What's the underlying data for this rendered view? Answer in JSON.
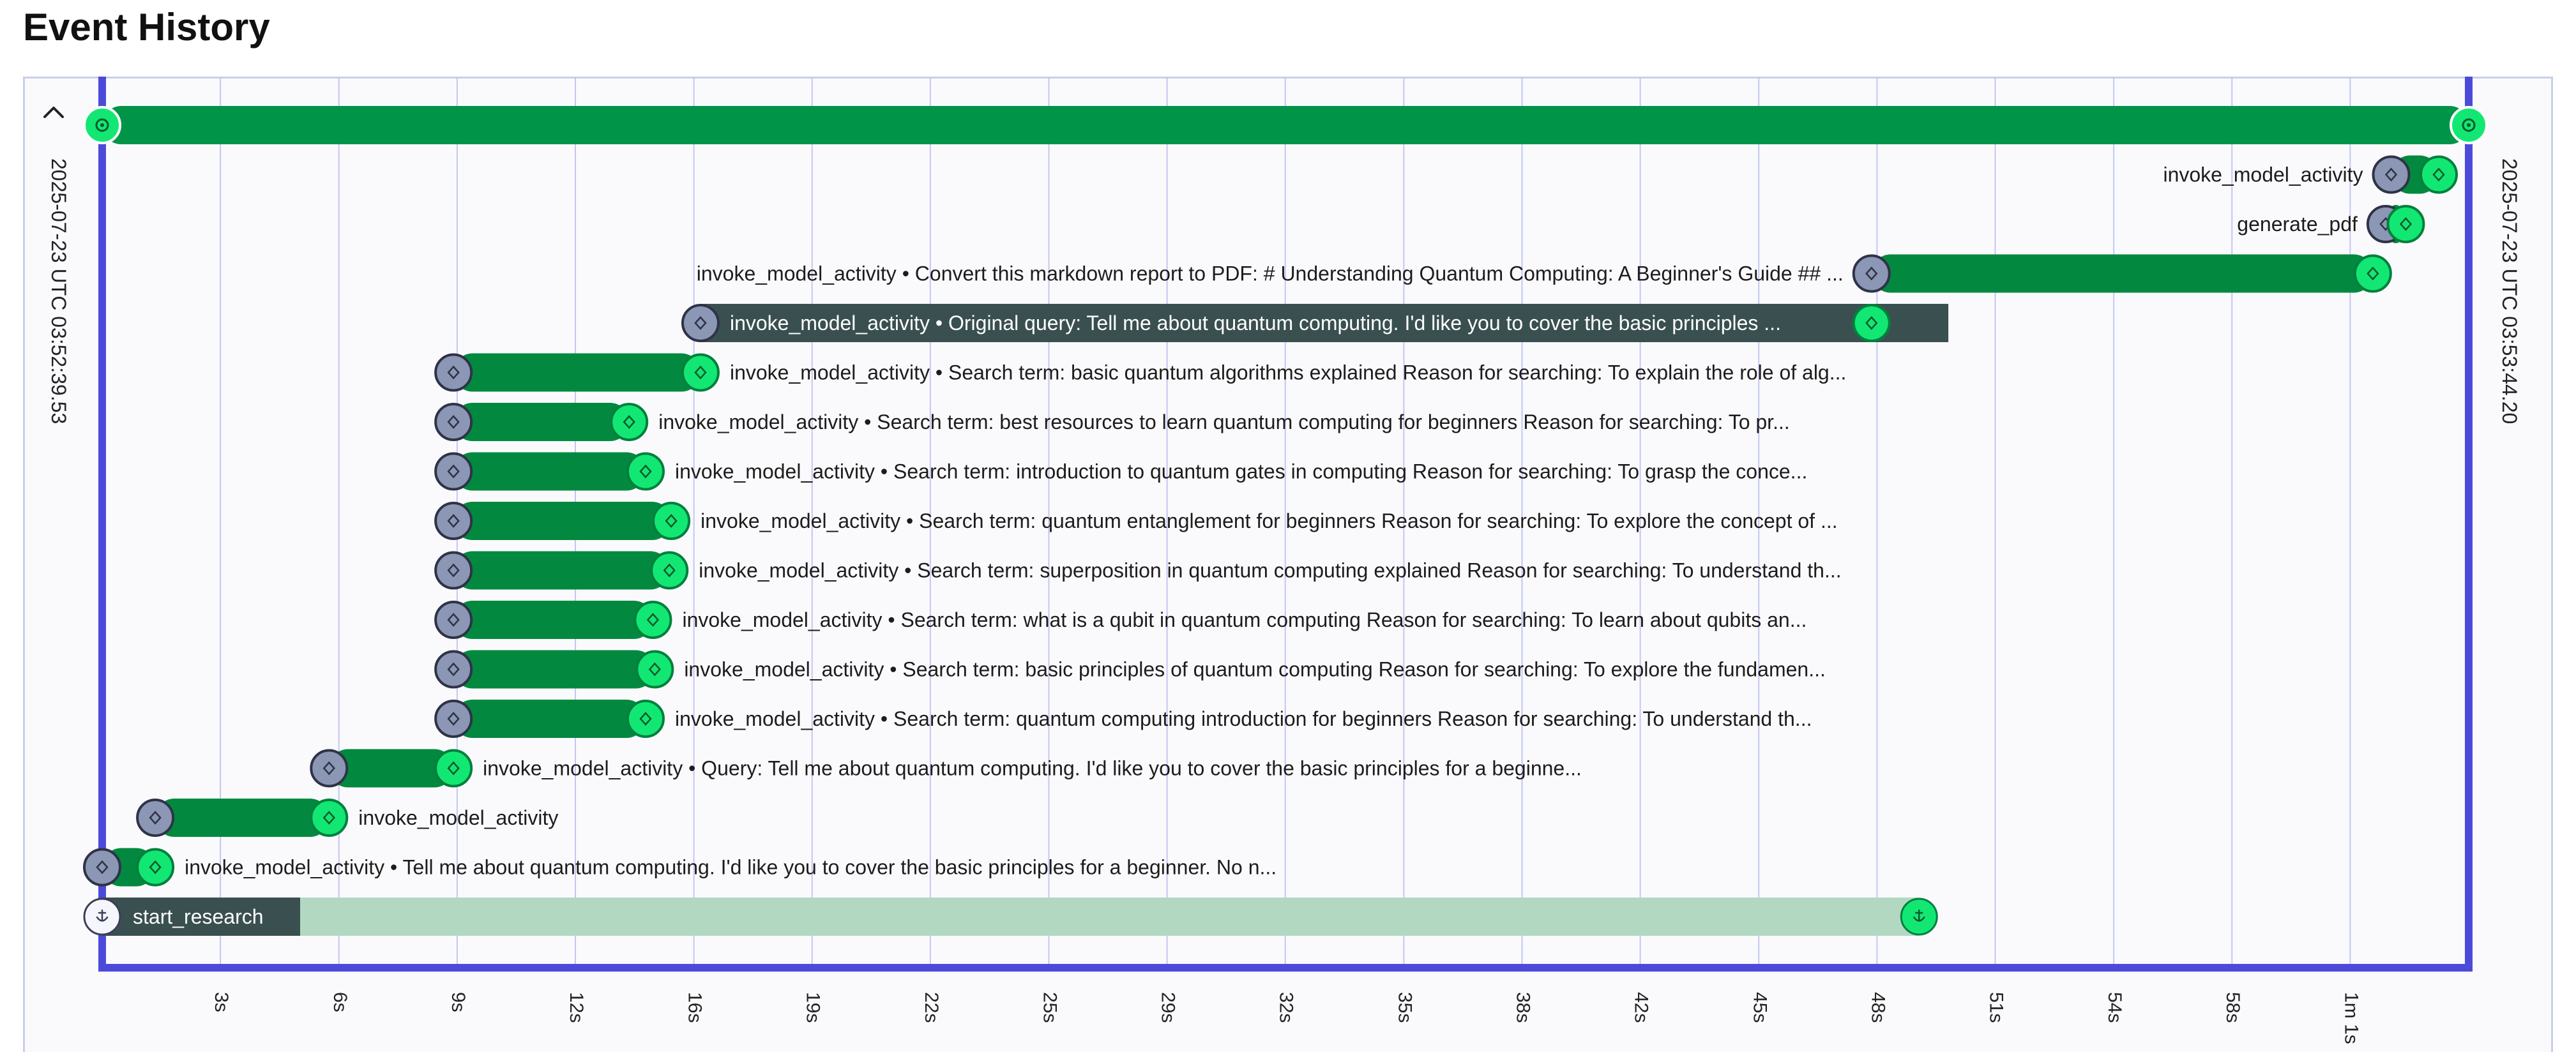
{
  "page": {
    "title": "Event History"
  },
  "timeline": {
    "start_label": "2025-07-23 UTC 03:52:39.53",
    "end_label": "2025-07-23 UTC 03:53:44.20",
    "duration_s": 64.67,
    "ticks": [
      "3s",
      "6s",
      "9s",
      "12s",
      "16s",
      "19s",
      "22s",
      "25s",
      "29s",
      "32s",
      "35s",
      "38s",
      "42s",
      "45s",
      "48s",
      "51s",
      "54s",
      "58s",
      "1m 1s"
    ],
    "tick_seconds": [
      3.23,
      6.47,
      9.7,
      12.93,
      16.17,
      19.4,
      22.63,
      25.87,
      29.1,
      32.33,
      35.57,
      38.8,
      42.03,
      45.27,
      48.5,
      51.73,
      54.97,
      58.2,
      61.43
    ],
    "colors": {
      "workflow": "#009448",
      "activity": "#02893f",
      "timer": "#b3d8c2",
      "start_node": "#8b97b4",
      "end_node": "#13e773",
      "frame": "#4c4bd9",
      "grid": "#c3c7f0",
      "highlight_label": "#3a5050"
    },
    "events": [
      {
        "start": 0,
        "end": 64.67,
        "label": "",
        "kind": "workflow",
        "row": 0,
        "side": "none"
      },
      {
        "start": 62.55,
        "end": 63.85,
        "label": "invoke_model_activity",
        "kind": "activity",
        "row": 1,
        "side": "left"
      },
      {
        "start": 62.4,
        "end": 62.95,
        "label": "generate_pdf",
        "kind": "activity",
        "row": 2,
        "side": "left"
      },
      {
        "start": 48.35,
        "end": 62.05,
        "label": "invoke_model_activity • Convert this markdown report to PDF: # Understanding Quantum Computing: A Beginner's Guide ## ...",
        "kind": "activity",
        "row": 3,
        "side": "left"
      },
      {
        "start": 16.35,
        "end": 48.35,
        "label": "invoke_model_activity • Original query: Tell me about quantum computing. I'd like you to cover the basic principles ...",
        "kind": "activity",
        "row": 4,
        "side": "inside"
      },
      {
        "start": 9.6,
        "end": 16.35,
        "label": "invoke_model_activity • Search term: basic quantum algorithms explained Reason for searching: To explain the role of alg...",
        "kind": "activity",
        "row": 5,
        "side": "right"
      },
      {
        "start": 9.6,
        "end": 14.4,
        "label": "invoke_model_activity • Search term: best resources to learn quantum computing for beginners Reason for searching: To pr...",
        "kind": "activity",
        "row": 6,
        "side": "right"
      },
      {
        "start": 9.6,
        "end": 14.85,
        "label": "invoke_model_activity • Search term: introduction to quantum gates in computing Reason for searching: To grasp the conce...",
        "kind": "activity",
        "row": 7,
        "side": "right"
      },
      {
        "start": 9.6,
        "end": 15.55,
        "label": "invoke_model_activity • Search term: quantum entanglement for beginners Reason for searching: To explore the concept of ...",
        "kind": "activity",
        "row": 8,
        "side": "right"
      },
      {
        "start": 9.6,
        "end": 15.5,
        "label": "invoke_model_activity • Search term: superposition in quantum computing explained Reason for searching: To understand th...",
        "kind": "activity",
        "row": 9,
        "side": "right"
      },
      {
        "start": 9.6,
        "end": 15.05,
        "label": "invoke_model_activity • Search term: what is a qubit in quantum computing Reason for searching: To learn about qubits an...",
        "kind": "activity",
        "row": 10,
        "side": "right"
      },
      {
        "start": 9.6,
        "end": 15.1,
        "label": "invoke_model_activity • Search term: basic principles of quantum computing Reason for searching: To explore the fundamen...",
        "kind": "activity",
        "row": 11,
        "side": "right"
      },
      {
        "start": 9.6,
        "end": 14.85,
        "label": "invoke_model_activity • Search term: quantum computing introduction for beginners Reason for searching: To understand th...",
        "kind": "activity",
        "row": 12,
        "side": "right"
      },
      {
        "start": 6.2,
        "end": 9.6,
        "label": "invoke_model_activity • Query: Tell me about quantum computing. I'd like you to cover the basic principles for a beginne...",
        "kind": "activity",
        "row": 13,
        "side": "right"
      },
      {
        "start": 1.45,
        "end": 6.2,
        "label": "invoke_model_activity",
        "kind": "activity",
        "row": 14,
        "side": "right"
      },
      {
        "start": 0,
        "end": 1.45,
        "label": "invoke_model_activity • Tell me about quantum computing. I'd like you to cover the basic principles for a beginner. No n...",
        "kind": "activity",
        "row": 15,
        "side": "right"
      },
      {
        "start": 0,
        "end": 49.65,
        "label": "start_research",
        "kind": "timer",
        "row": 16,
        "side": "inside-start"
      }
    ]
  }
}
